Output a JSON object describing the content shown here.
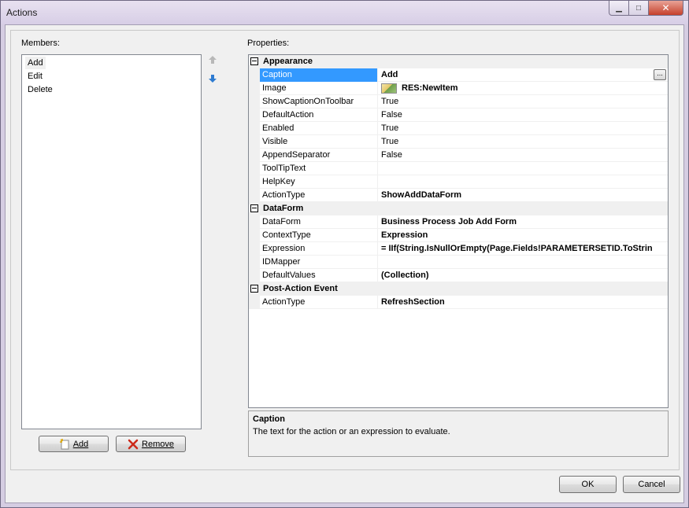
{
  "window": {
    "title": "Actions"
  },
  "members": {
    "label": "Members:",
    "items": [
      "Add",
      "Edit",
      "Delete"
    ],
    "selected_index": 0,
    "add_button": "Add",
    "remove_button": "Remove"
  },
  "properties": {
    "label": "Properties:",
    "categories": [
      {
        "name": "Appearance",
        "rows": [
          {
            "name": "Caption",
            "value": "Add",
            "bold": true,
            "selected": true,
            "ellipsis": "..."
          },
          {
            "name": "Image",
            "value": "RES:NewItem",
            "bold": true,
            "thumbnail": true
          },
          {
            "name": "ShowCaptionOnToolbar",
            "value": "True"
          },
          {
            "name": "DefaultAction",
            "value": "False"
          },
          {
            "name": "Enabled",
            "value": "True"
          },
          {
            "name": "Visible",
            "value": "True"
          },
          {
            "name": "AppendSeparator",
            "value": "False"
          },
          {
            "name": "ToolTipText",
            "value": ""
          },
          {
            "name": "HelpKey",
            "value": ""
          },
          {
            "name": "ActionType",
            "value": "ShowAddDataForm",
            "bold": true
          }
        ]
      },
      {
        "name": "DataForm",
        "rows": [
          {
            "name": "DataForm",
            "value": "Business Process Job Add Form",
            "bold": true
          },
          {
            "name": "ContextType",
            "value": "Expression",
            "bold": true
          },
          {
            "name": "Expression",
            "value": "= IIf(String.IsNullOrEmpty(Page.Fields!PARAMETERSETID.ToStrin",
            "bold": true
          },
          {
            "name": "IDMapper",
            "value": ""
          },
          {
            "name": "DefaultValues",
            "value": "(Collection)",
            "bold": true
          }
        ]
      },
      {
        "name": "Post-Action Event",
        "rows": [
          {
            "name": "ActionType",
            "value": "RefreshSection",
            "bold": true
          }
        ]
      }
    ]
  },
  "help": {
    "title": "Caption",
    "text": "The text for the action or an expression to evaluate."
  },
  "footer": {
    "ok": "OK",
    "cancel": "Cancel"
  },
  "icons": {
    "move_up": "arrow-up-icon",
    "move_down": "arrow-down-icon",
    "add": "add-item-icon",
    "remove": "remove-x-icon"
  },
  "colors": {
    "selection": "#3399ff",
    "category_bg": "#f0f0f0",
    "down_arrow": "#2e7bd1",
    "up_arrow_disabled": "#b8b8b8",
    "remove_icon": "#cc2a1a"
  }
}
